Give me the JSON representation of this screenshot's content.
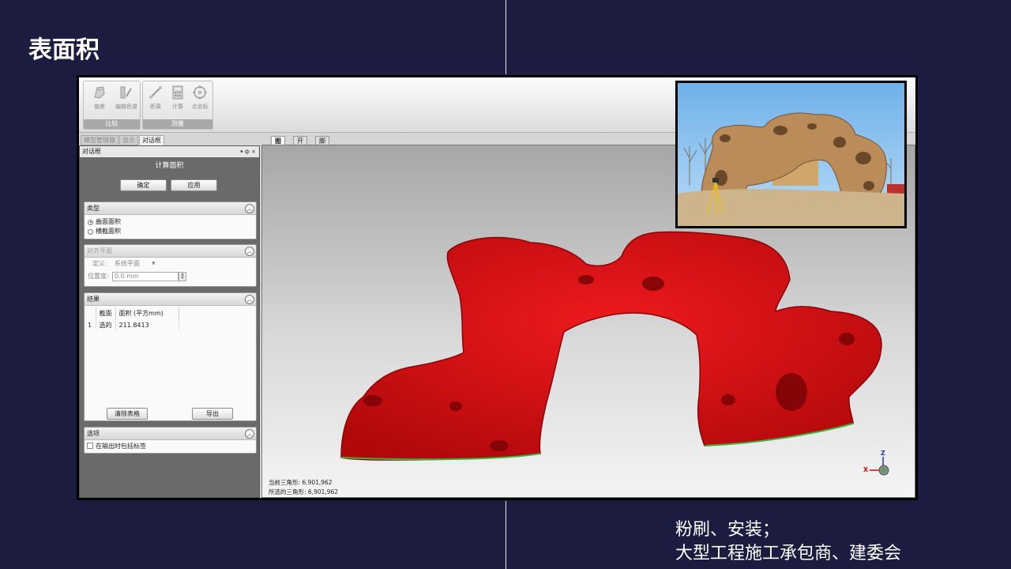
{
  "slide": {
    "title": "表面积",
    "caption_line1": "粉刷、安装；",
    "caption_line2": "大型工程施工承包商、建委会"
  },
  "ribbon": {
    "groups": [
      {
        "title": "比较",
        "buttons": [
          "偏差",
          "编辑色谱"
        ]
      },
      {
        "title": "测量",
        "buttons": [
          "距离",
          "计算",
          "点坐标"
        ]
      }
    ]
  },
  "panel_tabs": [
    "模型管理器",
    "显示",
    "对话框"
  ],
  "panel": {
    "header": "对话框",
    "calc_title": "计算面积",
    "ok_label": "确定",
    "apply_label": "应用",
    "type_section": {
      "title": "类型",
      "options": [
        "曲面面积",
        "横截面积"
      ],
      "selected": "曲面面积"
    },
    "align_section": {
      "title": "对齐平面",
      "define_label": "定义:",
      "define_value": "系统平面",
      "position_label": "位置度:",
      "position_value": "0.0 mm"
    },
    "result_section": {
      "title": "结果",
      "columns": [
        "截面",
        "面积 (平方mm)"
      ],
      "rows": [
        {
          "index": "1",
          "section": "选的",
          "area": "211.8413"
        }
      ],
      "clear_label": "清除表格",
      "export_label": "导出"
    },
    "options_section": {
      "title": "选项",
      "checkbox_label": "在输出时包括标签"
    }
  },
  "viewport": {
    "tabs": [
      "图形",
      "开始",
      "脚本"
    ],
    "current_triangles": "当前三角形: 6,901,962",
    "selected_triangles": "所选的三角形: 6,901,962",
    "axis_z": "Z",
    "axis_x": "X"
  },
  "colors": {
    "background": "#1c1c40",
    "model_red": "#d40d10",
    "sky": "#8ec3ef"
  }
}
